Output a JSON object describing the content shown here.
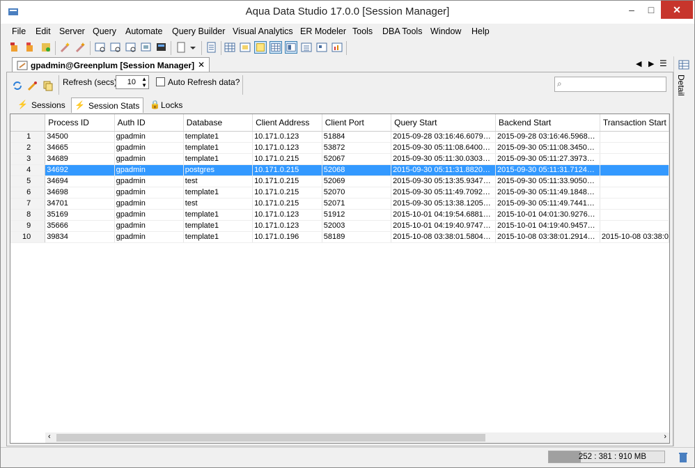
{
  "window": {
    "title": "Aqua Data Studio 17.0.0 [Session Manager]",
    "min": "–",
    "max": "□",
    "close": "✕"
  },
  "menu": [
    "File",
    "Edit",
    "Server",
    "Query",
    "Automate",
    "Query Builder",
    "Visual Analytics",
    "ER Modeler",
    "Tools",
    "DBA Tools",
    "Window",
    "Help"
  ],
  "doc_tab": {
    "label": "gpadmin@Greenplum [Session Manager]",
    "close": "✕"
  },
  "refresh": {
    "label": "Refresh (secs)",
    "value": "10",
    "auto_label": "Auto Refresh data?"
  },
  "search": {
    "placeholder": ""
  },
  "subtabs": [
    "Sessions",
    "Session Stats",
    "Locks"
  ],
  "side_tab": "Detail",
  "table": {
    "columns": [
      "",
      "Process ID",
      "Auth ID",
      "Database",
      "Client Address",
      "Client Port",
      "Query Start",
      "Backend Start",
      "Transaction Start"
    ],
    "rows": [
      [
        "1",
        "34500",
        "gpadmin",
        "template1",
        "10.171.0.123",
        "51884",
        "2015-09-28 03:16:46.6079…",
        "2015-09-28 03:16:46.5968…",
        ""
      ],
      [
        "2",
        "34665",
        "gpadmin",
        "template1",
        "10.171.0.123",
        "53872",
        "2015-09-30 05:11:08.6400…",
        "2015-09-30 05:11:08.3450…",
        ""
      ],
      [
        "3",
        "34689",
        "gpadmin",
        "template1",
        "10.171.0.215",
        "52067",
        "2015-09-30 05:11:30.0303…",
        "2015-09-30 05:11:27.3973…",
        ""
      ],
      [
        "4",
        "34692",
        "gpadmin",
        "postgres",
        "10.171.0.215",
        "52068",
        "2015-09-30 05:11:31.8820…",
        "2015-09-30 05:11:31.7124…",
        ""
      ],
      [
        "5",
        "34694",
        "gpadmin",
        "test",
        "10.171.0.215",
        "52069",
        "2015-09-30 05:13:35.9347…",
        "2015-09-30 05:11:33.9050…",
        ""
      ],
      [
        "6",
        "34698",
        "gpadmin",
        "template1",
        "10.171.0.215",
        "52070",
        "2015-09-30 05:11:49.7092…",
        "2015-09-30 05:11:49.1848…",
        ""
      ],
      [
        "7",
        "34701",
        "gpadmin",
        "test",
        "10.171.0.215",
        "52071",
        "2015-09-30 05:13:38.1205…",
        "2015-09-30 05:11:49.7441…",
        ""
      ],
      [
        "8",
        "35169",
        "gpadmin",
        "template1",
        "10.171.0.123",
        "51912",
        "2015-10-01 04:19:54.6881…",
        "2015-10-01 04:01:30.9276…",
        ""
      ],
      [
        "9",
        "35666",
        "gpadmin",
        "template1",
        "10.171.0.123",
        "52003",
        "2015-10-01 04:19:40.9747…",
        "2015-10-01 04:19:40.9457…",
        ""
      ],
      [
        "10",
        "39834",
        "gpadmin",
        "template1",
        "10.171.0.196",
        "58189",
        "2015-10-08 03:38:01.5804…",
        "2015-10-08 03:38:01.2914…",
        "2015-10-08 03:38:0"
      ]
    ],
    "selected_row": 3
  },
  "status": {
    "memory": "252 : 381 : 910 MB"
  },
  "colors": {
    "selection": "#3399ff",
    "close": "#c7352c"
  }
}
